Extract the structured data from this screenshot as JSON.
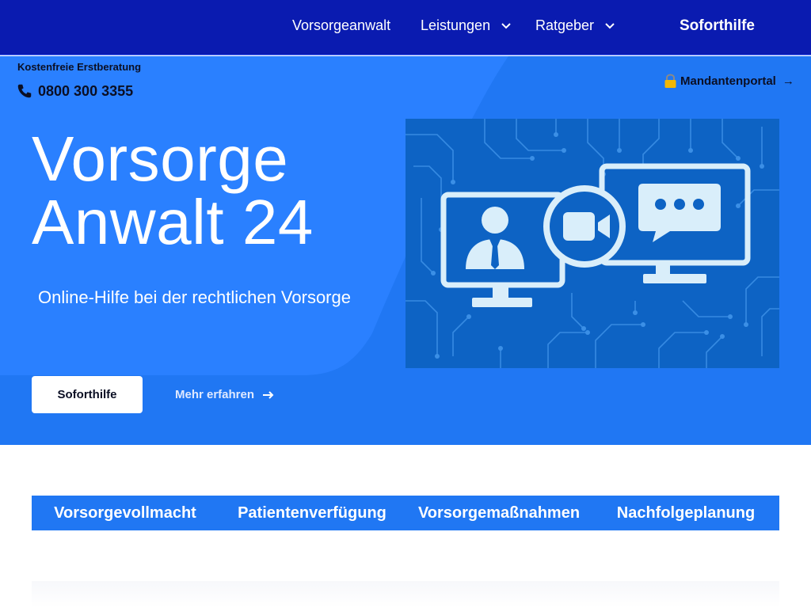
{
  "nav": {
    "links": [
      {
        "label": "Vorsorgeanwalt",
        "dropdown": false
      },
      {
        "label": "Leistungen",
        "dropdown": true
      },
      {
        "label": "Ratgeber",
        "dropdown": true
      }
    ],
    "cta_label": "Soforthilfe"
  },
  "topbar": {
    "consult_label": "Kostenfreie Erstberatung",
    "phone": "0800 300 3355",
    "portal_label": "Mandantenportal",
    "portal_arrow": "→"
  },
  "hero": {
    "title_line1": "Vorsorge",
    "title_line2": "Anwalt 24",
    "subtitle": "Online-Hilfe bei der rechtlichen Vorsorge",
    "primary_button": "Soforthilfe",
    "secondary_link": "Mehr erfahren"
  },
  "tabs": [
    {
      "label": "Vorsorgevollmacht"
    },
    {
      "label": "Patientenverfügung"
    },
    {
      "label": "Vorsorgemaßnahmen"
    },
    {
      "label": "Nachfolgeplanung"
    }
  ],
  "colors": {
    "nav_bg": "#0a1bb0",
    "hero_bg": "#2077f3",
    "illustration_bg": "#0d63c4",
    "text_dark": "#0b0f24"
  },
  "icons": {
    "phone": "phone-icon",
    "lock": "lock-icon",
    "arrow": "arrow-right-icon",
    "chevron": "chevron-down-icon"
  }
}
